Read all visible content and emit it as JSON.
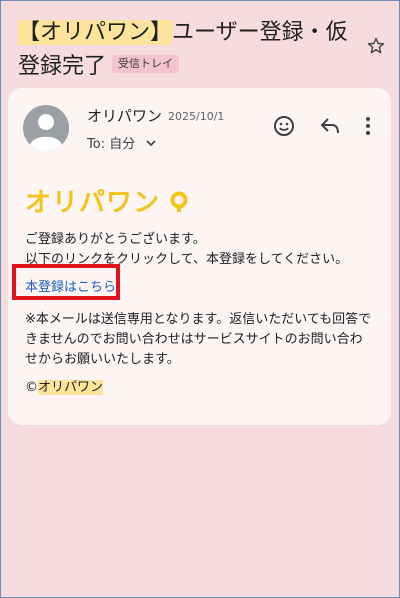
{
  "subject": {
    "line1_hl": "【オリパワン】",
    "line1_rest": "ユーザー登録・仮",
    "line2": "登録完了",
    "label": "受信トレイ"
  },
  "sender": {
    "name": "オリパワン",
    "date": "2025/10/1",
    "to": "To: 自分"
  },
  "logo_text": "オリパワン",
  "body": {
    "p1_line1": "ご登録ありがとうございます。",
    "p1_line2": "以下のリンクをクリックして、本登録をしてください。",
    "link": "本登録はこちら",
    "p2_line1": "※本メールは送信専用となります。返信いただいても回答で",
    "p2_line2": "きませんのでお問い合わせはサービスサイトのお問い合わ",
    "p2_line3": "せからお願いいたします。",
    "copyright_symbol": "©",
    "copyright_name": "オリパワン"
  },
  "colors": {
    "background": "#f7dcdf",
    "highlight": "#fce59b",
    "link": "#1a5fc0",
    "logo": "#f3c21b",
    "annotation_box": "#e0141c"
  },
  "icons": [
    "star-icon",
    "avatar-icon",
    "chevron-down-icon",
    "emoji-icon",
    "reply-icon",
    "more-vert-icon"
  ]
}
